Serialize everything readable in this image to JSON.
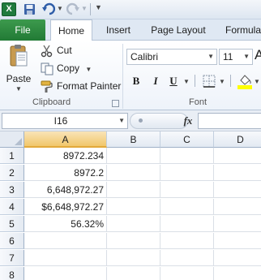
{
  "qat": {
    "app_icon_label": "X",
    "icons": [
      "excel-logo-icon",
      "save-icon",
      "undo-icon",
      "redo-icon",
      "customize-dropdown-icon"
    ]
  },
  "tabs": [
    "File",
    "Home",
    "Insert",
    "Page Layout",
    "Formula"
  ],
  "active_tab": "Home",
  "ribbon": {
    "clipboard": {
      "paste": "Paste",
      "cut": "Cut",
      "copy": "Copy",
      "format_painter": "Format Painter",
      "label": "Clipboard"
    },
    "font": {
      "name": "Calibri",
      "size": "11",
      "label": "Font",
      "bold": "B",
      "italic": "I",
      "underline": "U",
      "grow": "A"
    }
  },
  "formula_bar": {
    "name_box": "I16",
    "fx": "fx",
    "formula": ""
  },
  "grid": {
    "columns": [
      "A",
      "B",
      "C",
      "D"
    ],
    "selected_column": "A",
    "rows": [
      "1",
      "2",
      "3",
      "4",
      "5",
      "6",
      "7",
      "8"
    ],
    "cells": {
      "A1": "8972.234",
      "A2": "8972.2",
      "A3": "6,648,972.27",
      "A4": "$6,648,972.27",
      "A5": "56.32%"
    }
  },
  "colors": {
    "file_tab": "#217a35",
    "ribbon_bg": "#eef3fa",
    "header_selected": "#f1c76b"
  }
}
